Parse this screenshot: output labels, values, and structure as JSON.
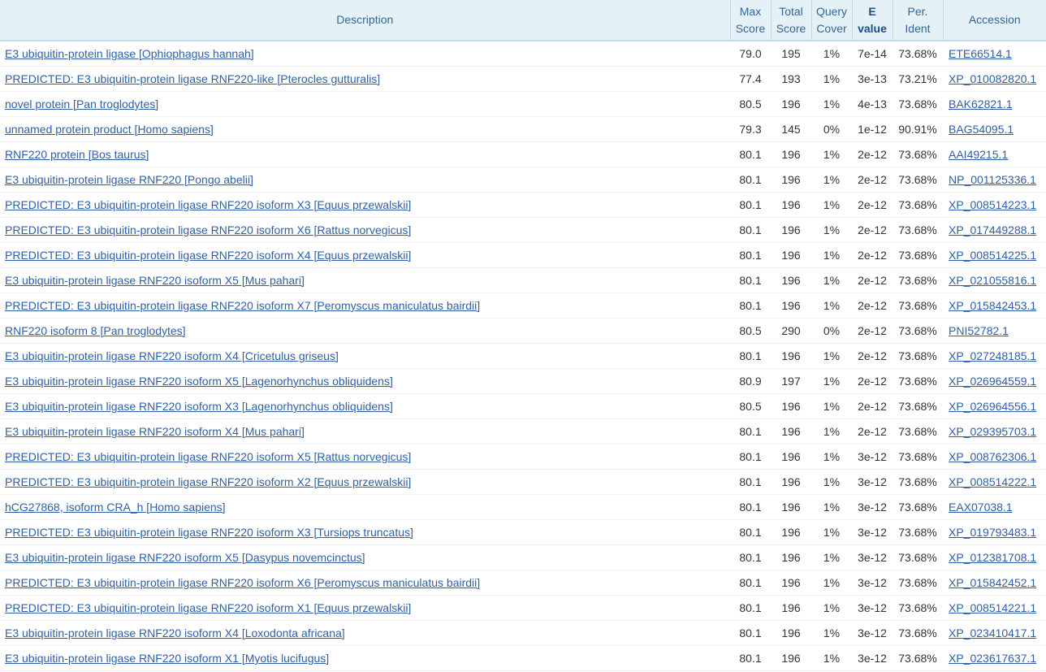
{
  "columns": {
    "description": "Description",
    "max_score": [
      "Max",
      "Score"
    ],
    "total_score": [
      "Total",
      "Score"
    ],
    "query_cover": [
      "Query",
      "Cover"
    ],
    "e_value": [
      "E",
      "value"
    ],
    "per_ident": [
      "Per.",
      "Ident"
    ],
    "accession": "Accession"
  },
  "sorted_column": "e_value",
  "colors": {
    "header_bg": "#e4f1f7",
    "header_text": "#336699",
    "link": "#2f5fa8"
  },
  "rows": [
    {
      "description": "E3 ubiquitin-protein ligase [Ophiophagus hannah]",
      "max_score": "79.0",
      "total_score": "195",
      "query_cover": "1%",
      "e_value": "7e-14",
      "per_ident": "73.68%",
      "accession": "ETE66514.1"
    },
    {
      "description": "PREDICTED: E3 ubiquitin-protein ligase RNF220-like [Pterocles gutturalis]",
      "max_score": "77.4",
      "total_score": "193",
      "query_cover": "1%",
      "e_value": "3e-13",
      "per_ident": "73.21%",
      "accession": "XP_010082820.1"
    },
    {
      "description": "novel protein [Pan troglodytes]",
      "max_score": "80.5",
      "total_score": "196",
      "query_cover": "1%",
      "e_value": "4e-13",
      "per_ident": "73.68%",
      "accession": "BAK62821.1"
    },
    {
      "description": "unnamed protein product [Homo sapiens]",
      "max_score": "79.3",
      "total_score": "145",
      "query_cover": "0%",
      "e_value": "1e-12",
      "per_ident": "90.91%",
      "accession": "BAG54095.1"
    },
    {
      "description": "RNF220 protein [Bos taurus]",
      "max_score": "80.1",
      "total_score": "196",
      "query_cover": "1%",
      "e_value": "2e-12",
      "per_ident": "73.68%",
      "accession": "AAI49215.1"
    },
    {
      "description": "E3 ubiquitin-protein ligase RNF220 [Pongo abelii]",
      "max_score": "80.1",
      "total_score": "196",
      "query_cover": "1%",
      "e_value": "2e-12",
      "per_ident": "73.68%",
      "accession": "NP_001125336.1"
    },
    {
      "description": "PREDICTED: E3 ubiquitin-protein ligase RNF220 isoform X3 [Equus przewalskii]",
      "max_score": "80.1",
      "total_score": "196",
      "query_cover": "1%",
      "e_value": "2e-12",
      "per_ident": "73.68%",
      "accession": "XP_008514223.1"
    },
    {
      "description": "PREDICTED: E3 ubiquitin-protein ligase RNF220 isoform X6 [Rattus norvegicus]",
      "max_score": "80.1",
      "total_score": "196",
      "query_cover": "1%",
      "e_value": "2e-12",
      "per_ident": "73.68%",
      "accession": "XP_017449288.1"
    },
    {
      "description": "PREDICTED: E3 ubiquitin-protein ligase RNF220 isoform X4 [Equus przewalskii]",
      "max_score": "80.1",
      "total_score": "196",
      "query_cover": "1%",
      "e_value": "2e-12",
      "per_ident": "73.68%",
      "accession": "XP_008514225.1"
    },
    {
      "description": "E3 ubiquitin-protein ligase RNF220 isoform X5 [Mus pahari]",
      "max_score": "80.1",
      "total_score": "196",
      "query_cover": "1%",
      "e_value": "2e-12",
      "per_ident": "73.68%",
      "accession": "XP_021055816.1"
    },
    {
      "description": "PREDICTED: E3 ubiquitin-protein ligase RNF220 isoform X7 [Peromyscus maniculatus bairdii]",
      "max_score": "80.1",
      "total_score": "196",
      "query_cover": "1%",
      "e_value": "2e-12",
      "per_ident": "73.68%",
      "accession": "XP_015842453.1"
    },
    {
      "description": "RNF220 isoform 8 [Pan troglodytes]",
      "max_score": "80.5",
      "total_score": "290",
      "query_cover": "0%",
      "e_value": "2e-12",
      "per_ident": "73.68%",
      "accession": "PNI52782.1"
    },
    {
      "description": "E3 ubiquitin-protein ligase RNF220 isoform X4 [Cricetulus griseus]",
      "max_score": "80.1",
      "total_score": "196",
      "query_cover": "1%",
      "e_value": "2e-12",
      "per_ident": "73.68%",
      "accession": "XP_027248185.1"
    },
    {
      "description": "E3 ubiquitin-protein ligase RNF220 isoform X5 [Lagenorhynchus obliquidens]",
      "max_score": "80.9",
      "total_score": "197",
      "query_cover": "1%",
      "e_value": "2e-12",
      "per_ident": "73.68%",
      "accession": "XP_026964559.1"
    },
    {
      "description": "E3 ubiquitin-protein ligase RNF220 isoform X3 [Lagenorhynchus obliquidens]",
      "max_score": "80.5",
      "total_score": "196",
      "query_cover": "1%",
      "e_value": "2e-12",
      "per_ident": "73.68%",
      "accession": "XP_026964556.1"
    },
    {
      "description": "E3 ubiquitin-protein ligase RNF220 isoform X4 [Mus pahari]",
      "max_score": "80.1",
      "total_score": "196",
      "query_cover": "1%",
      "e_value": "2e-12",
      "per_ident": "73.68%",
      "accession": "XP_029395703.1"
    },
    {
      "description": "PREDICTED: E3 ubiquitin-protein ligase RNF220 isoform X5 [Rattus norvegicus]",
      "max_score": "80.1",
      "total_score": "196",
      "query_cover": "1%",
      "e_value": "3e-12",
      "per_ident": "73.68%",
      "accession": "XP_008762306.1"
    },
    {
      "description": "PREDICTED: E3 ubiquitin-protein ligase RNF220 isoform X2 [Equus przewalskii]",
      "max_score": "80.1",
      "total_score": "196",
      "query_cover": "1%",
      "e_value": "3e-12",
      "per_ident": "73.68%",
      "accession": "XP_008514222.1"
    },
    {
      "description": "hCG27868, isoform CRA_h [Homo sapiens]",
      "max_score": "80.1",
      "total_score": "196",
      "query_cover": "1%",
      "e_value": "3e-12",
      "per_ident": "73.68%",
      "accession": "EAX07038.1"
    },
    {
      "description": "PREDICTED: E3 ubiquitin-protein ligase RNF220 isoform X3 [Tursiops truncatus]",
      "max_score": "80.1",
      "total_score": "196",
      "query_cover": "1%",
      "e_value": "3e-12",
      "per_ident": "73.68%",
      "accession": "XP_019793483.1"
    },
    {
      "description": "E3 ubiquitin-protein ligase RNF220 isoform X5 [Dasypus novemcinctus]",
      "max_score": "80.1",
      "total_score": "196",
      "query_cover": "1%",
      "e_value": "3e-12",
      "per_ident": "73.68%",
      "accession": "XP_012381708.1"
    },
    {
      "description": "PREDICTED: E3 ubiquitin-protein ligase RNF220 isoform X6 [Peromyscus maniculatus bairdii]",
      "max_score": "80.1",
      "total_score": "196",
      "query_cover": "1%",
      "e_value": "3e-12",
      "per_ident": "73.68%",
      "accession": "XP_015842452.1"
    },
    {
      "description": "PREDICTED: E3 ubiquitin-protein ligase RNF220 isoform X1 [Equus przewalskii]",
      "max_score": "80.1",
      "total_score": "196",
      "query_cover": "1%",
      "e_value": "3e-12",
      "per_ident": "73.68%",
      "accession": "XP_008514221.1"
    },
    {
      "description": "E3 ubiquitin-protein ligase RNF220 isoform X4 [Loxodonta africana]",
      "max_score": "80.1",
      "total_score": "196",
      "query_cover": "1%",
      "e_value": "3e-12",
      "per_ident": "73.68%",
      "accession": "XP_023410417.1"
    },
    {
      "description": "E3 ubiquitin-protein ligase RNF220 isoform X1 [Myotis lucifugus]",
      "max_score": "80.1",
      "total_score": "196",
      "query_cover": "1%",
      "e_value": "3e-12",
      "per_ident": "73.68%",
      "accession": "XP_023617637.1"
    }
  ]
}
